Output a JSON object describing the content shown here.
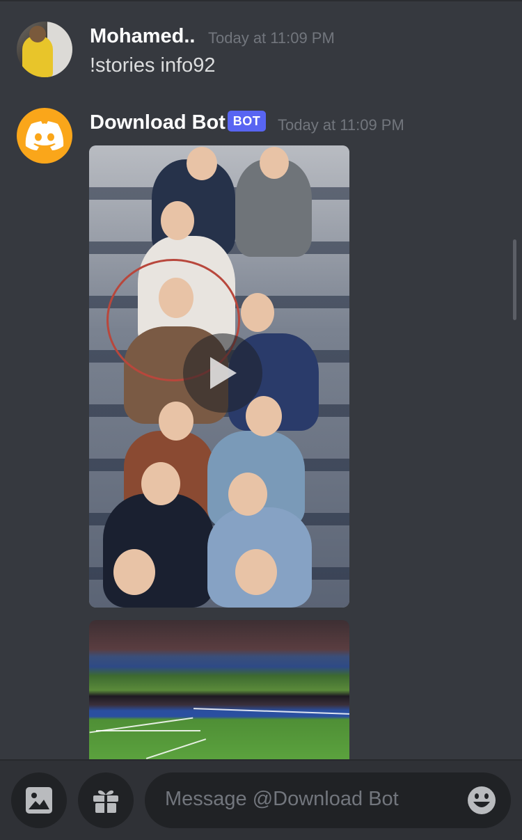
{
  "messages": [
    {
      "author": "Mohamed..",
      "timestamp": "Today at 11:09 PM",
      "text": "!stories info92"
    },
    {
      "author": "Download Bot",
      "badge": "BOT",
      "timestamp": "Today at 11:09 PM"
    }
  ],
  "composer": {
    "placeholder": "Message @Download Bot"
  },
  "icons": {
    "user_avatar": "user-avatar",
    "bot_avatar": "discord-logo-icon",
    "play": "play-icon",
    "image_upload": "image-icon",
    "gift": "gift-icon",
    "emoji": "emoji-icon"
  },
  "colors": {
    "background": "#36393f",
    "bot_badge": "#5865f2",
    "bot_avatar": "#faa61a",
    "timestamp": "#72767d",
    "input_bg": "#202225"
  }
}
